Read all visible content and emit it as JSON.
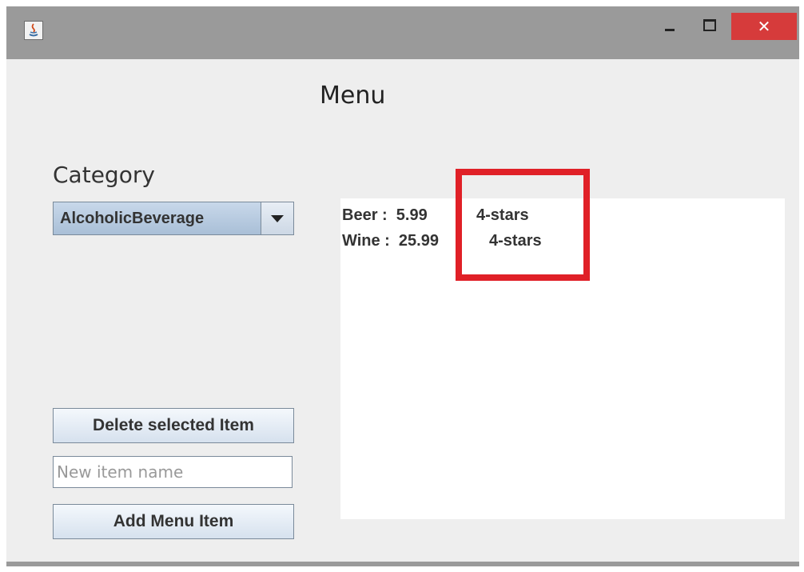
{
  "window": {
    "controls": {
      "minimize_icon": "minimize-icon",
      "maximize_icon": "maximize-icon",
      "close_icon": "close-icon",
      "close_glyph": "✕"
    },
    "app_icon": "java-icon"
  },
  "header": {
    "title": "Menu"
  },
  "sidebar": {
    "category_label": "Category",
    "category_selected": "AlcoholicBeverage",
    "delete_button": "Delete selected Item",
    "new_item_placeholder": "New item name",
    "new_item_value": "",
    "add_button": "Add Menu Item"
  },
  "list": {
    "items": [
      {
        "text": "Beer :  5.99",
        "rating": "4-stars"
      },
      {
        "text": "Wine :  25.99",
        "rating": "4-stars"
      }
    ]
  },
  "annotation": {
    "highlight_color": "#e02027"
  },
  "colors": {
    "titlebar": "#9a9a9a",
    "client_background": "#eeeeee",
    "close_button": "#d63b3b"
  }
}
